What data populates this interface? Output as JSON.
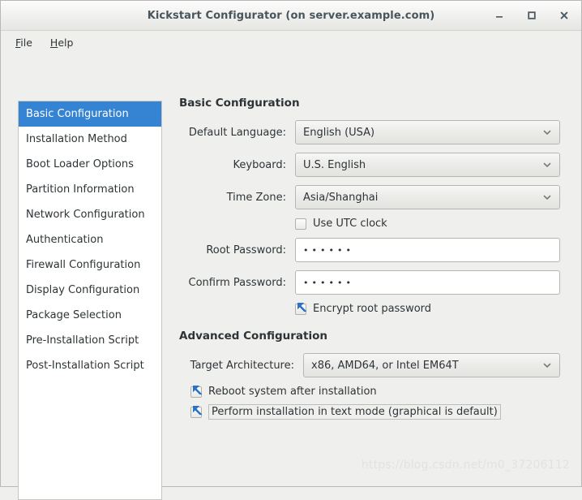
{
  "window": {
    "title": "Kickstart Configurator (on server.example.com)",
    "controls": {
      "minimize": "minimize-icon",
      "maximize": "maximize-icon",
      "close": "close-icon"
    },
    "accent_color": "#3584d4",
    "background_color": "#efefee"
  },
  "menubar": {
    "items": [
      {
        "mnemonic": "F",
        "rest": "ile"
      },
      {
        "mnemonic": "H",
        "rest": "elp"
      }
    ]
  },
  "sidebar": {
    "selected_index": 0,
    "items": [
      {
        "label": "Basic Configuration"
      },
      {
        "label": "Installation Method"
      },
      {
        "label": "Boot Loader Options"
      },
      {
        "label": "Partition Information"
      },
      {
        "label": "Network Configuration"
      },
      {
        "label": "Authentication"
      },
      {
        "label": "Firewall Configuration"
      },
      {
        "label": "Display Configuration"
      },
      {
        "label": "Package Selection"
      },
      {
        "label": "Pre-Installation Script"
      },
      {
        "label": "Post-Installation Script"
      }
    ]
  },
  "basic": {
    "heading": "Basic Configuration",
    "language": {
      "label": "Default Language:",
      "value": "English (USA)"
    },
    "keyboard": {
      "label": "Keyboard:",
      "value": "U.S. English"
    },
    "timezone": {
      "label": "Time Zone:",
      "value": "Asia/Shanghai"
    },
    "utc": {
      "label": "Use UTC clock",
      "checked": false
    },
    "root_password": {
      "label": "Root Password:",
      "value": "••••••"
    },
    "confirm_password": {
      "label": "Confirm Password:",
      "value": "••••••"
    },
    "encrypt": {
      "label": "Encrypt root password",
      "checked": true
    }
  },
  "advanced": {
    "heading": "Advanced Configuration",
    "architecture": {
      "label": "Target Architecture:",
      "value": "x86, AMD64, or Intel EM64T"
    },
    "reboot": {
      "label": "Reboot system after installation",
      "checked": true
    },
    "textmode": {
      "label": "Perform installation in text mode (graphical is default)",
      "checked": true,
      "focused": true
    }
  },
  "watermark": {
    "text": "https://blog.csdn.net/m0_37206112"
  }
}
